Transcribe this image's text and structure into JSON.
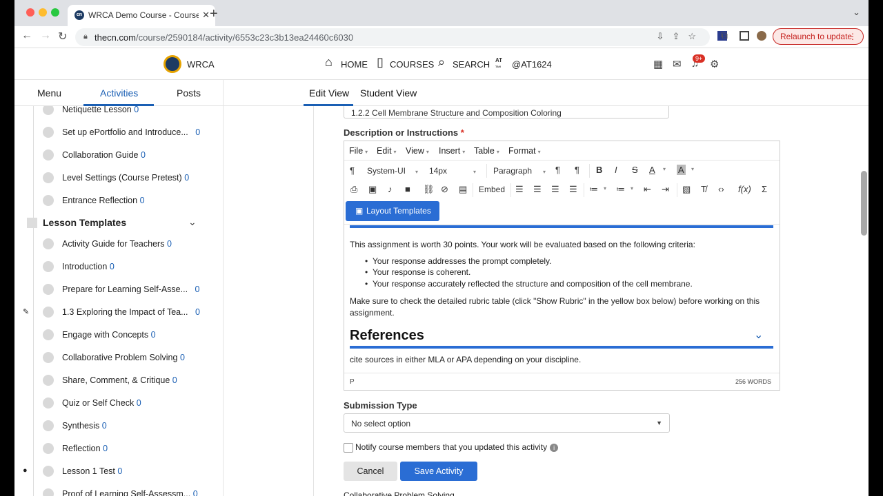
{
  "browser": {
    "tab_title": "WRCA Demo Course - Course",
    "tab_favicon_text": "cn",
    "url_domain": "thecn.com",
    "url_path": "/course/2590184/activity/6553c23c3b13ea24460c6030",
    "relaunch_label": "Relaunch to update"
  },
  "header": {
    "brand": "WRCA",
    "nav": [
      "HOME",
      "COURSES",
      "SEARCH",
      "@AT1624"
    ],
    "avatar_initials_top": "AT",
    "avatar_initials_bottom": "TAN",
    "notifications_badge": "9+"
  },
  "subnav": {
    "left_tabs": [
      "Menu",
      "Activities",
      "Posts"
    ],
    "active_left": "Activities",
    "view_tabs": [
      "Edit View",
      "Student View"
    ],
    "active_view": "Edit View"
  },
  "sidebar": {
    "items_top": [
      {
        "label": "Netiquette Lesson",
        "count": "0"
      },
      {
        "label": "Set up ePortfolio and Introduce...",
        "count": "0"
      },
      {
        "label": "Collaboration Guide",
        "count": "0"
      },
      {
        "label": "Level Settings (Course Pretest)",
        "count": "0"
      },
      {
        "label": "Entrance Reflection",
        "count": "0"
      }
    ],
    "section_title": "Lesson Templates",
    "items_bottom": [
      {
        "label": "Activity Guide for Teachers",
        "count": "0"
      },
      {
        "label": "Introduction",
        "count": "0"
      },
      {
        "label": "Prepare for Learning Self-Asse...",
        "count": "0"
      },
      {
        "label": "1.3 Exploring the Impact of Tea...",
        "count": "0"
      },
      {
        "label": "Engage with Concepts",
        "count": "0"
      },
      {
        "label": "Collaborative Problem Solving",
        "count": "0"
      },
      {
        "label": "Share, Comment, & Critique",
        "count": "0"
      },
      {
        "label": "Quiz or Self Check",
        "count": "0"
      },
      {
        "label": "Synthesis",
        "count": "0"
      },
      {
        "label": "Reflection",
        "count": "0"
      },
      {
        "label": "Lesson 1 Test",
        "count": "0"
      },
      {
        "label": "Proof of Learning Self-Assessm...",
        "count": "0"
      }
    ]
  },
  "form": {
    "title_value": "1.2.2 Cell Membrane Structure and Composition Coloring",
    "description_label": "Description or Instructions",
    "required_mark": "*",
    "editor": {
      "menus": [
        "File",
        "Edit",
        "View",
        "Insert",
        "Table",
        "Format"
      ],
      "font_family": "System-UI",
      "font_size": "14px",
      "block_format": "Paragraph",
      "embed_label": "Embed",
      "fx_label": "f(x)",
      "sigma_label": "Σ",
      "layout_templates_label": "Layout Templates",
      "intro_text": "This assignment is worth 30 points. Your work will be evaluated based on the following criteria:",
      "criteria": [
        "Your response addresses the prompt completely.",
        "Your response is coherent.",
        "Your response accurately reflected the structure and composition of the cell membrane."
      ],
      "rubric_text_1": "Make sure to check the detailed rubric table (click \"Show Rubric\" in the yellow box below) before working on this",
      "rubric_text_2": "assignment.",
      "references_heading": "References",
      "references_text": "cite sources in either MLA or APA depending on your discipline.",
      "status_path": "P",
      "word_count": "256 WORDS"
    },
    "submission_type_label": "Submission Type",
    "submission_type_value": "No select option",
    "notify_label": "Notify course members that you updated this activity",
    "cancel_label": "Cancel",
    "save_label": "Save Activity",
    "next_item_cutoff": "Collaborative Problem Solving"
  }
}
